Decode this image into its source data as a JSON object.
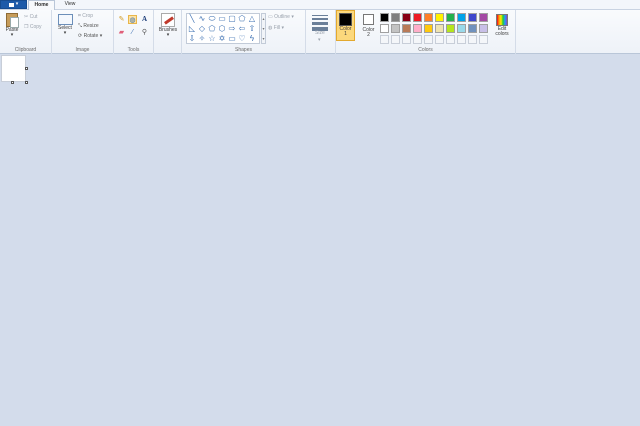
{
  "tabs": {
    "home": "Home",
    "view": "View"
  },
  "clipboard": {
    "paste": "Paste",
    "cut": "Cut",
    "copy": "Copy",
    "group": "Clipboard"
  },
  "image": {
    "select": "Select",
    "crop": "Crop",
    "resize": "Resize",
    "rotate": "Rotate",
    "group": "Image"
  },
  "tools": {
    "group": "Tools",
    "icons": [
      "pencil-icon",
      "fill-icon",
      "text-icon",
      "eraser-icon",
      "color-picker-icon",
      "magnifier-icon"
    ]
  },
  "brushes": {
    "label": "Brushes"
  },
  "shapes": {
    "group": "Shapes",
    "outline": "Outline",
    "fill": "Fill"
  },
  "size": {
    "label": "Size"
  },
  "colors": {
    "group": "Colors",
    "color1_line1": "Color",
    "color1_line2": "1",
    "color2_line1": "Color",
    "color2_line2": "2",
    "edit_line1": "Edit",
    "edit_line2": "colors",
    "color1_value": "#000000",
    "color2_value": "#ffffff",
    "palette_row1": [
      "#000000",
      "#7f7f7f",
      "#880015",
      "#ed1c24",
      "#ff7f27",
      "#fff200",
      "#22b14c",
      "#00a2e8",
      "#3f48cc",
      "#a349a4"
    ],
    "palette_row2": [
      "#ffffff",
      "#c3c3c3",
      "#b97a57",
      "#ffaec9",
      "#ffc90e",
      "#efe4b0",
      "#b5e61d",
      "#99d9ea",
      "#7092be",
      "#c8bfe7"
    ],
    "palette_row3_empty": 10
  }
}
